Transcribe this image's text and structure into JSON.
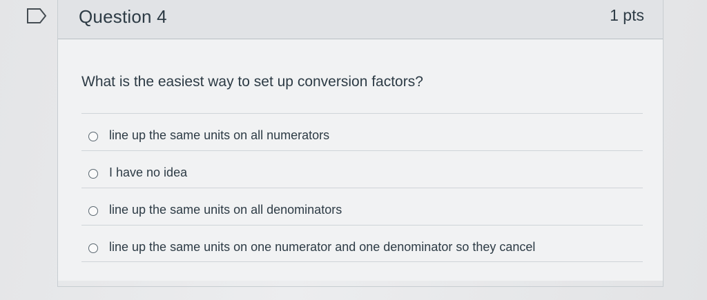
{
  "question": {
    "title": "Question 4",
    "points": "1 pts",
    "text": "What is the easiest way to set up conversion factors?",
    "flag_icon": "flag-icon"
  },
  "answers": [
    {
      "label": "line up the same units on all numerators",
      "selected": false
    },
    {
      "label": "I have no idea",
      "selected": false
    },
    {
      "label": "line up the same units on all denominators",
      "selected": false
    },
    {
      "label": "line up the same units on one numerator and one denominator so they cancel",
      "selected": false
    }
  ],
  "colors": {
    "text": "#2d3b45",
    "header_bg": "#e1e3e6",
    "body_bg": "#f1f2f3",
    "border": "#c7cdd1"
  }
}
